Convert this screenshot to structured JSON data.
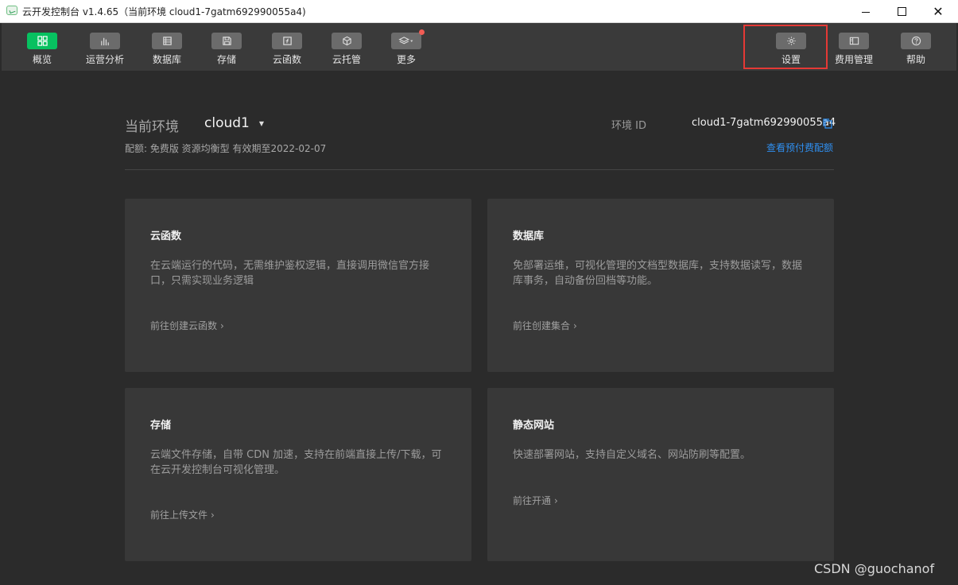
{
  "window": {
    "title": "云开发控制台 v1.4.65（当前环境 cloud1-7gatm692990055a4)"
  },
  "toolbar": {
    "items": [
      {
        "label": "概览",
        "icon": "grid-icon"
      },
      {
        "label": "运营分析",
        "icon": "bar-chart-icon"
      },
      {
        "label": "数据库",
        "icon": "database-icon"
      },
      {
        "label": "存储",
        "icon": "save-icon"
      },
      {
        "label": "云函数",
        "icon": "function-icon"
      },
      {
        "label": "云托管",
        "icon": "cube-icon"
      },
      {
        "label": "更多",
        "icon": "layers-icon"
      },
      {
        "label": "设置",
        "icon": "gear-icon"
      },
      {
        "label": "费用管理",
        "icon": "panel-icon"
      },
      {
        "label": "帮助",
        "icon": "help-icon"
      }
    ],
    "active_color": "#07c160"
  },
  "env": {
    "label": "当前环境",
    "name": "cloud1",
    "id_label": "环境 ID",
    "id_value": "cloud1-7gatm692990055a4",
    "quota": "配额: 免费版 资源均衡型 有效期至2022-02-07",
    "quota_link": "查看预付费配额"
  },
  "cards": [
    {
      "title": "云函数",
      "desc": "在云端运行的代码，无需维护鉴权逻辑，直接调用微信官方接口，只需实现业务逻辑",
      "link": "前往创建云函数"
    },
    {
      "title": "数据库",
      "desc": "免部署运维，可视化管理的文档型数据库，支持数据读写，数据库事务，自动备份回档等功能。",
      "link": "前往创建集合"
    },
    {
      "title": "存储",
      "desc": "云端文件存储，自带 CDN 加速，支持在前端直接上传/下载，可在云开发控制台可视化管理。",
      "link": "前往上传文件"
    },
    {
      "title": "静态网站",
      "desc": "快速部署网站，支持自定义域名、网站防刷等配置。",
      "link": "前往开通"
    }
  ],
  "watermark": "CSDN @guochanof",
  "colors": {
    "link": "#2f8ff0",
    "highlight": "#e53935",
    "badge": "#f25c54"
  }
}
